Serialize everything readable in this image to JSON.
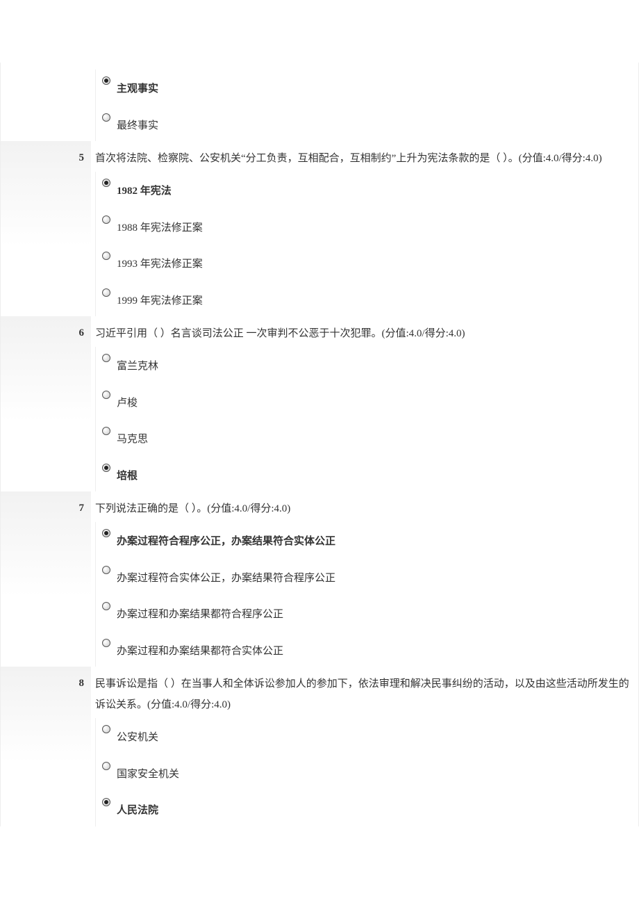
{
  "prelude_options": [
    {
      "text": "主观事实",
      "selected": true
    },
    {
      "text": "最终事实",
      "selected": false
    }
  ],
  "questions": [
    {
      "num": "5",
      "text": "首次将法院、检察院、公安机关“分工负责，互相配合，互相制约”上升为宪法条款的是（  ）。(分值:4.0/得分:4.0)",
      "options": [
        {
          "text": "1982 年宪法",
          "selected": true
        },
        {
          "text": "1988 年宪法修正案",
          "selected": false
        },
        {
          "text": "1993 年宪法修正案",
          "selected": false
        },
        {
          "text": "1999 年宪法修正案",
          "selected": false
        }
      ]
    },
    {
      "num": "6",
      "text": "习近平引用（  ）名言谈司法公正 一次审判不公恶于十次犯罪。(分值:4.0/得分:4.0)",
      "options": [
        {
          "text": "富兰克林",
          "selected": false
        },
        {
          "text": "卢梭",
          "selected": false
        },
        {
          "text": "马克思",
          "selected": false
        },
        {
          "text": "培根",
          "selected": true
        }
      ]
    },
    {
      "num": "7",
      "text": "下列说法正确的是（  ）。(分值:4.0/得分:4.0)",
      "options": [
        {
          "text": "办案过程符合程序公正，办案结果符合实体公正",
          "selected": true
        },
        {
          "text": "办案过程符合实体公正，办案结果符合程序公正",
          "selected": false
        },
        {
          "text": "办案过程和办案结果都符合程序公正",
          "selected": false
        },
        {
          "text": "办案过程和办案结果都符合实体公正",
          "selected": false
        }
      ]
    },
    {
      "num": "8",
      "text": "民事诉讼是指（  ）在当事人和全体诉讼参加人的参加下，依法审理和解决民事纠纷的活动，以及由这些活动所发生的诉讼关系。(分值:4.0/得分:4.0)",
      "options": [
        {
          "text": "公安机关",
          "selected": false
        },
        {
          "text": "国家安全机关",
          "selected": false
        },
        {
          "text": "人民法院",
          "selected": true
        }
      ]
    }
  ]
}
